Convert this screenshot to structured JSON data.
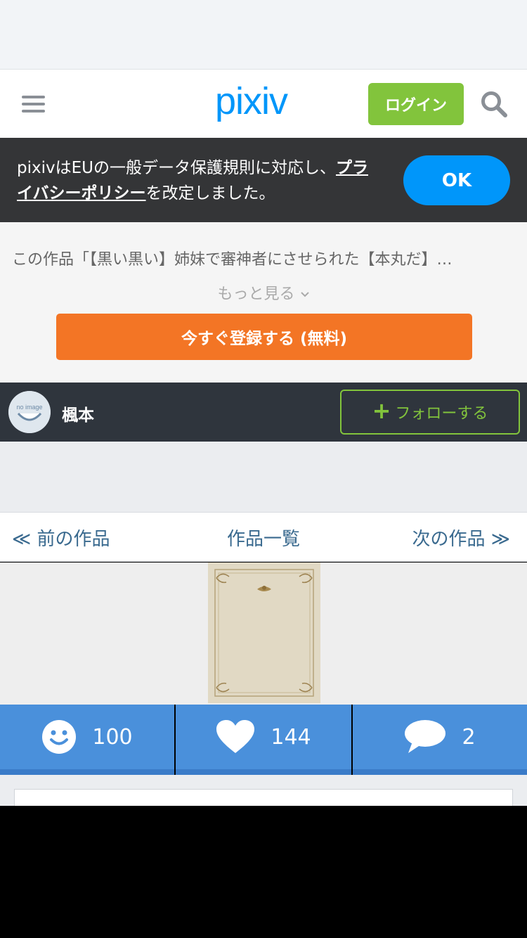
{
  "header": {
    "logo_text": "pixiv",
    "login_label": "ログイン",
    "icons": {
      "menu": "hamburger-icon",
      "search": "search-icon"
    }
  },
  "gdpr": {
    "text_before": "pixivはEUの一般データ保護規則に対応し、",
    "link_text": "プライバシーポリシー",
    "text_after": "を改定しました。",
    "ok_label": "OK"
  },
  "work": {
    "description": "この作品「【黒い黒い】姉妹で審神者にさせられた【本丸だ】…",
    "more_label": "もっと見る",
    "register_label": "今すぐ登録する (無料)"
  },
  "author": {
    "avatar_text": "no image",
    "name": "楓本",
    "follow_label": "フォローする"
  },
  "navigation": {
    "prev_label": "≪ 前の作品",
    "list_label": "作品一覧",
    "next_label": "次の作品 ≫"
  },
  "stats": {
    "good_count": "100",
    "like_count": "144",
    "comment_count": "2"
  },
  "colors": {
    "brand_blue": "#0096fa",
    "login_green": "#82c43c",
    "register_orange": "#f37525",
    "stats_blue": "#4a90db",
    "nav_text": "#3a6a8f"
  }
}
